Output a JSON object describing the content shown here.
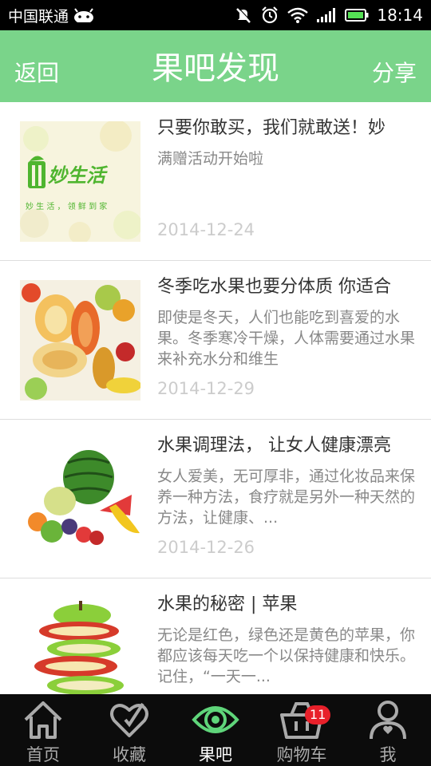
{
  "status_bar": {
    "carrier": "中国联通",
    "time": "18:14"
  },
  "header": {
    "back_label": "返回",
    "title": "果吧发现",
    "share_label": "分享",
    "background": "#7ad48a"
  },
  "articles": [
    {
      "title": "只要你敢买，我们就敢送！妙",
      "summary": "满赠活动开始啦",
      "date": "2014-12-24",
      "image_logo_text": "妙生活",
      "image_slogan_text": "妙 生 活 ， 领 鲜 到 家"
    },
    {
      "title": "冬季吃水果也要分体质 你适合",
      "summary": "即使是冬天，人们也能吃到喜爱的水果。冬季寒冷干燥，人体需要通过水果来补充水分和维生",
      "date": "2014-12-29"
    },
    {
      "title": "水果调理法， 让女人健康漂亮",
      "summary": "女人爱美，无可厚非，通过化妆品来保养一种方法，食疗就是另外一种天然的方法，让健康、...",
      "date": "2014-12-26"
    },
    {
      "title": "水果的秘密 | 苹果",
      "summary": "无论是红色，绿色还是黄色的苹果，你都应该每天吃一个以保持健康和快乐。记住，“一天一...",
      "date": ""
    }
  ],
  "tabs": [
    {
      "label": "首页",
      "icon": "home-icon"
    },
    {
      "label": "收藏",
      "icon": "heart-icon"
    },
    {
      "label": "果吧",
      "icon": "eye-icon",
      "active": true
    },
    {
      "label": "购物车",
      "icon": "basket-icon",
      "badge": "11"
    },
    {
      "label": "我",
      "icon": "person-icon"
    }
  ],
  "colors": {
    "accent": "#7ad48a",
    "active_tab": "#5fd57a",
    "badge": "#e8202a"
  }
}
